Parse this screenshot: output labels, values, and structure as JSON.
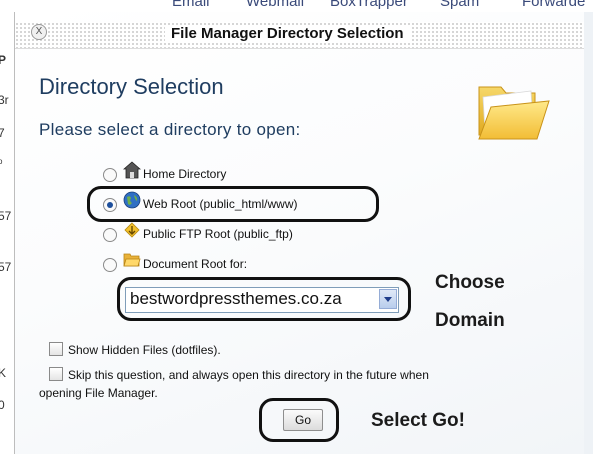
{
  "background": {
    "nav_items": [
      "Email",
      "Webmail",
      "BoxTrapper",
      "Spam",
      "Forwarde"
    ],
    "left_fragments": [
      "P",
      "3r",
      "7",
      "o",
      "57",
      "57",
      "K",
      "0"
    ]
  },
  "dialog": {
    "title": "File Manager Directory Selection",
    "close_glyph": "X",
    "heading": "Directory Selection",
    "subheading": "Please select a directory to open:",
    "options": [
      {
        "label": "Home Directory",
        "icon": "home-icon",
        "checked": false
      },
      {
        "label": "Web Root (public_html/www)",
        "icon": "globe-icon",
        "checked": true
      },
      {
        "label": "Public FTP Root (public_ftp)",
        "icon": "ftp-icon",
        "checked": false
      },
      {
        "label": "Document Root for:",
        "icon": "folder-icon",
        "checked": false
      }
    ],
    "domain_select": {
      "value": "bestwordpressthemes.co.za"
    },
    "show_hidden_label": "Show Hidden Files (dotfiles).",
    "skip_label_line1": "Skip this question, and always open this directory in the future when",
    "skip_label_line2": "opening File Manager.",
    "go_label": "Go"
  },
  "annotations": {
    "choose": "Choose",
    "domain": "Domain",
    "select_go": "Select Go!"
  },
  "colors": {
    "heading": "#1f3d60",
    "radio_selected": "#1d4f9c",
    "select_border": "#7f9db9",
    "annotation_ring": "#111111"
  }
}
